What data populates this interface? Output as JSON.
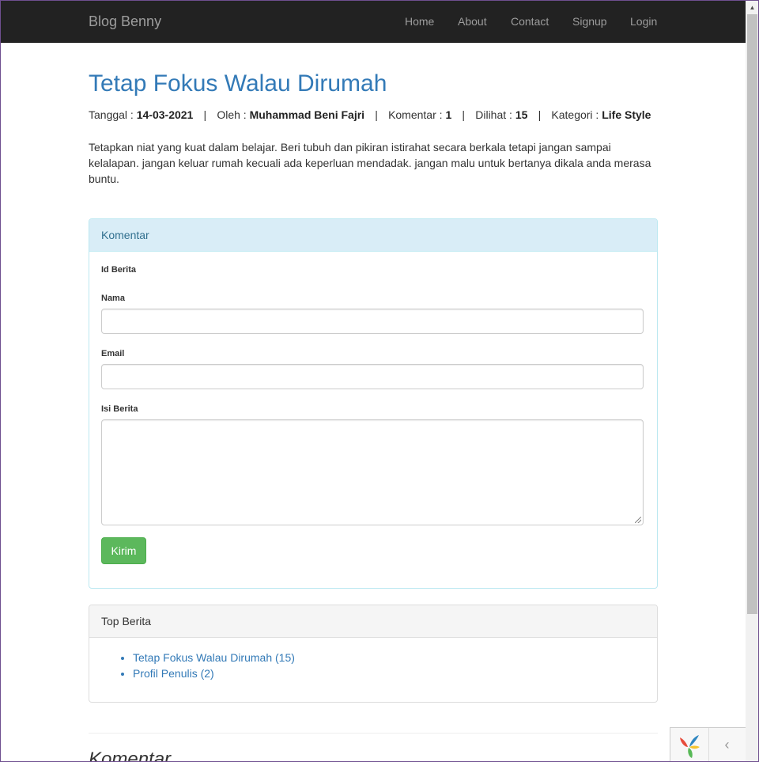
{
  "navbar": {
    "brand": "Blog Benny",
    "items": [
      {
        "label": "Home"
      },
      {
        "label": "About"
      },
      {
        "label": "Contact"
      },
      {
        "label": "Signup"
      },
      {
        "label": "Login"
      }
    ]
  },
  "article": {
    "title": "Tetap Fokus Walau Dirumah",
    "meta": {
      "date_label": "Tanggal :",
      "date": "14-03-2021",
      "author_label": "Oleh :",
      "author": "Muhammad Beni Fajri",
      "comments_label": "Komentar :",
      "comments": "1",
      "views_label": "Dilihat :",
      "views": "15",
      "category_label": "Kategori :",
      "category": "Life Style",
      "separator": "|"
    },
    "body": "Tetapkan niat yang kuat dalam belajar. Beri tubuh dan pikiran istirahat secara berkala tetapi jangan sampai kelalapan. jangan keluar rumah kecuali ada keperluan mendadak. jangan malu untuk bertanya dikala anda merasa buntu."
  },
  "comment_form": {
    "heading": "Komentar",
    "id_label": "Id Berita",
    "name_label": "Nama",
    "name_value": "",
    "email_label": "Email",
    "email_value": "",
    "content_label": "Isi Berita",
    "content_value": "",
    "submit_label": "Kirim"
  },
  "top_news": {
    "heading": "Top Berita",
    "items": [
      {
        "label": "Tetap Fokus Walau Dirumah (15)"
      },
      {
        "label": "Profil Penulis (2)"
      }
    ]
  },
  "comments_section": {
    "title": "Komentar"
  },
  "icons": {
    "debug_logo": "yii-logo-icon",
    "collapse": "chevron-left-icon",
    "scroll_up": "scroll-up-arrow-icon"
  },
  "colors": {
    "navbar_bg": "#222222",
    "link": "#337ab7",
    "panel_info_bg": "#d9edf7",
    "success": "#5cb85c"
  }
}
